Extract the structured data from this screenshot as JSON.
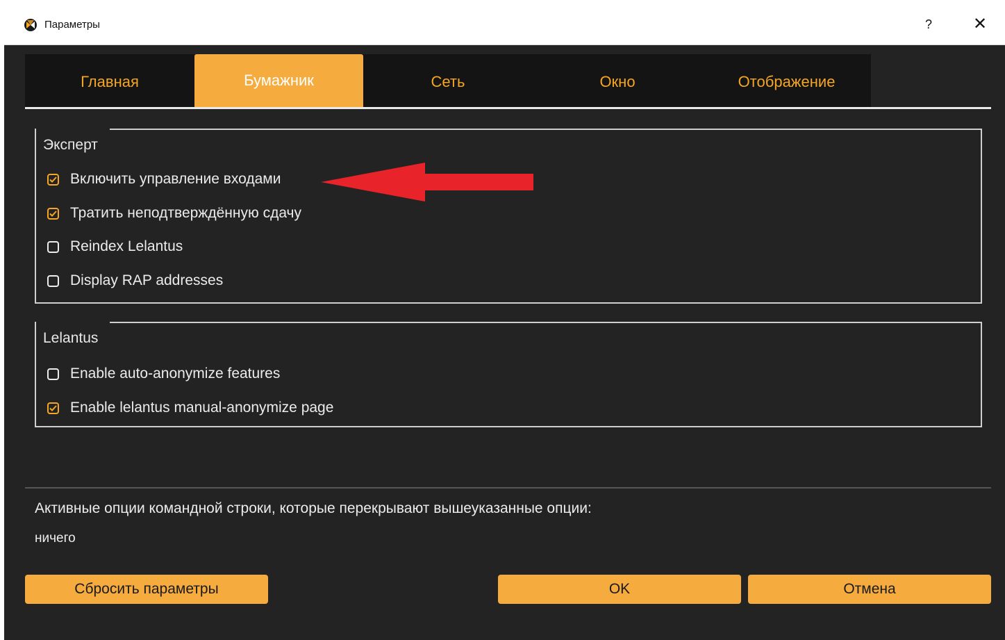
{
  "window": {
    "title": "Параметры",
    "help_label": "?",
    "close_label": "✕",
    "icon": "app-logo-icon"
  },
  "tabs": [
    {
      "label": "Главная",
      "active": false
    },
    {
      "label": "Бумажник",
      "active": true
    },
    {
      "label": "Сеть",
      "active": false
    },
    {
      "label": "Окно",
      "active": false
    },
    {
      "label": "Отображение",
      "active": false
    }
  ],
  "expert_group": {
    "title": "Эксперт",
    "options": [
      {
        "label": "Включить управление входами",
        "checked": true
      },
      {
        "label": "Тратить неподтверждённую сдачу",
        "checked": true
      },
      {
        "label": "Reindex Lelantus",
        "checked": false
      },
      {
        "label": "Display RAP addresses",
        "checked": false
      }
    ]
  },
  "lelantus_group": {
    "title": "Lelantus",
    "options": [
      {
        "label": "Enable auto-anonymize features",
        "checked": false
      },
      {
        "label": "Enable lelantus manual-anonymize page",
        "checked": true
      }
    ]
  },
  "cmdline": {
    "label": "Активные опции командной строки, которые перекрывают вышеуказанные опции:",
    "value": "ничего"
  },
  "buttons": {
    "reset": "Сбросить параметры",
    "ok": "OK",
    "cancel": "Отмена"
  },
  "colors": {
    "accent": "#f5ab3e",
    "background": "#232323",
    "tabbar": "#141414",
    "annotation_arrow": "#e8232a"
  }
}
